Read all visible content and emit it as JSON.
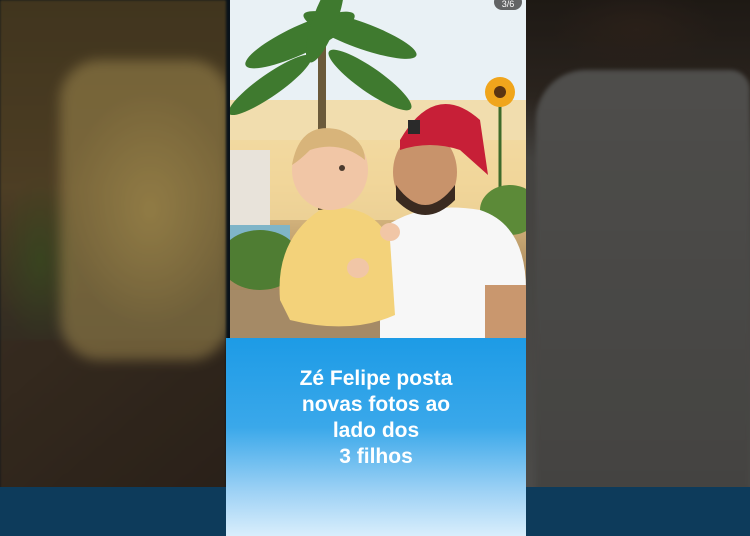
{
  "card": {
    "counter": "3/6",
    "caption_lines": [
      "Zé Felipe posta",
      "novas fotos ao",
      "lado dos",
      "3 filhos"
    ]
  },
  "colors": {
    "caption_blue": "#1d9be6",
    "bottom_band": "#0d3b5b"
  },
  "icons": {
    "photo": "photo-of-man-holding-baby"
  }
}
